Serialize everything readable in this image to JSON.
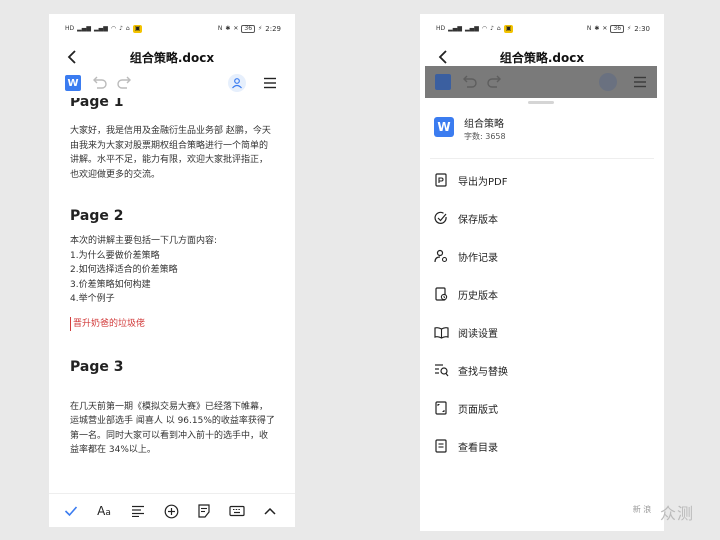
{
  "left_phone": {
    "status": {
      "left_icons": [
        "HD",
        "4G",
        "4G",
        "Wi-Fi",
        "TikTok",
        "Shield",
        "Badge"
      ],
      "right_icons": [
        "NFC",
        "Bluetooth",
        "Silent",
        "36%"
      ],
      "battery": "36",
      "time": "2:29"
    },
    "title": "组合策略.docx",
    "toolbar": {
      "logo": "W"
    },
    "content": {
      "p1_heading": "Page 1",
      "p1_text": "大家好，我是信用及金融衍生品业务部 赵鹏，今天由我来为大家对股票期权组合策略进行一个简单的讲解。水平不足，能力有限，欢迎大家批评指正，也欢迎做更多的交流。",
      "p2_heading": "Page 2",
      "p2_lines": [
        "本次的讲解主要包括一下几方面内容:",
        "1.为什么要做价差策略",
        "2.如何选择适合的价差策略",
        "3.价差策略如何构建",
        "4.举个例子"
      ],
      "p2_highlight": "晋升奶爸的垃圾佬",
      "p3_heading": "Page 3",
      "p3_text": "在几天前第一期《模拟交易大赛》已经落下帷幕，运城营业部选手 闻喜人 以 96.15%的收益率获得了第一名。同时大家可以看到冲入前十的选手中，收益率都在 34%以上。"
    }
  },
  "right_phone": {
    "status": {
      "left_icons": [
        "HD",
        "4G",
        "4G",
        "Wi-Fi",
        "TikTok",
        "Shield",
        "Badge"
      ],
      "right_icons": [
        "NFC",
        "Bluetooth",
        "Silent",
        "36%"
      ],
      "battery": "36",
      "time": "2:30"
    },
    "title": "组合策略.docx",
    "sheet": {
      "doc_icon": "W",
      "doc_name": "组合策略",
      "word_count": "字数:  3658",
      "menu": [
        {
          "label": "导出为PDF",
          "icon": "pdf-export-icon"
        },
        {
          "label": "保存版本",
          "icon": "check-circle-icon"
        },
        {
          "label": "协作记录",
          "icon": "user-gear-icon"
        },
        {
          "label": "历史版本",
          "icon": "history-icon"
        },
        {
          "label": "阅读设置",
          "icon": "book-icon"
        },
        {
          "label": "查找与替换",
          "icon": "find-replace-icon"
        },
        {
          "label": "页面版式",
          "icon": "page-layout-icon"
        },
        {
          "label": "查看目录",
          "icon": "toc-icon"
        }
      ]
    }
  },
  "watermark": {
    "badge": "新 浪",
    "text": "众测"
  },
  "colors": {
    "accent": "#3b7cf0",
    "highlight_red": "#d23c3c"
  }
}
